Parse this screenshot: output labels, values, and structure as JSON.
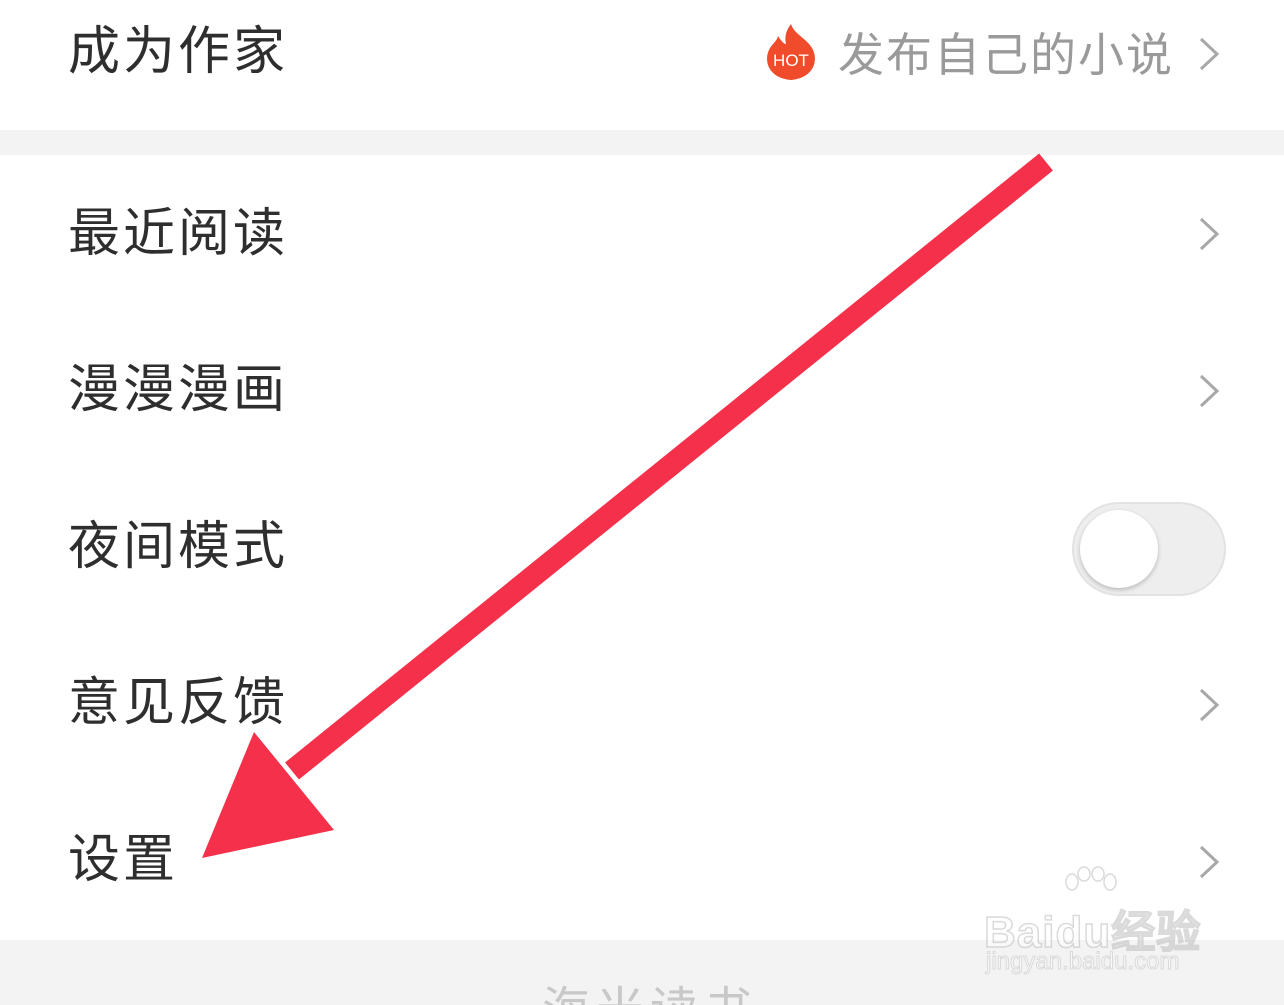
{
  "menu": {
    "writer": {
      "label": "成为作家",
      "hot_badge": "HOT",
      "hot_text": "发布自己的小说",
      "icon": "hot-flame-icon"
    },
    "items": [
      {
        "label": "最近阅读",
        "icon": "chevron-right-icon"
      },
      {
        "label": "漫漫漫画",
        "icon": "chevron-right-icon"
      },
      {
        "label": "夜间模式",
        "toggle_on": false
      },
      {
        "label": "意见反馈",
        "icon": "chevron-right-icon"
      },
      {
        "label": "设置",
        "icon": "chevron-right-icon"
      }
    ],
    "bottom_partial_text": "海米读书"
  },
  "overlay": {
    "arrow_color": "#f5304a",
    "watermark_brand": "Baidu经验",
    "watermark_url": "jingyan.baidu.com"
  },
  "colors": {
    "separator": "#f3f3f3",
    "label": "#2e2e2e",
    "secondary": "#9a9a9a",
    "hot_flame": "#f04b2a"
  }
}
